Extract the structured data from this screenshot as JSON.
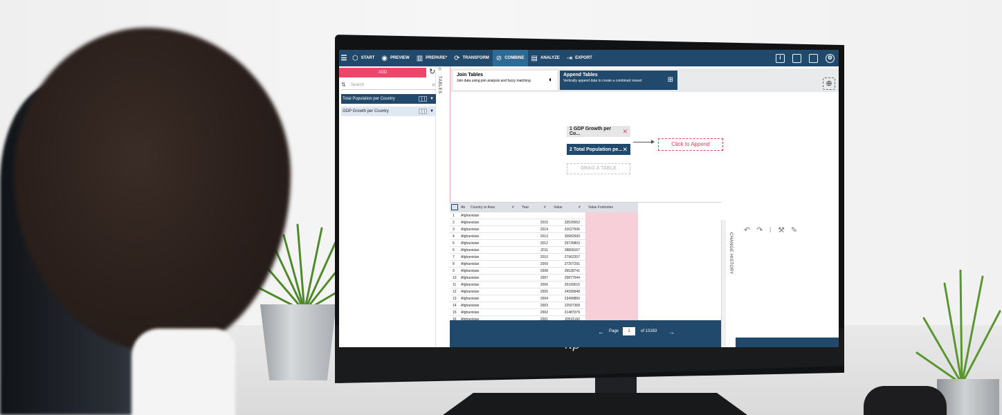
{
  "toolbar": {
    "items": [
      {
        "label": "START",
        "icon": "cube-icon"
      },
      {
        "label": "PREVIEW",
        "icon": "eye-icon"
      },
      {
        "label": "PREPARE*",
        "icon": "columns-icon"
      },
      {
        "label": "TRANSFORM",
        "icon": "cycle-icon"
      },
      {
        "label": "COMBINE",
        "icon": "combine-icon",
        "active": true
      },
      {
        "label": "ANALYZE",
        "icon": "clipboard-icon"
      },
      {
        "label": "EXPORT",
        "icon": "export-arrow-icon"
      }
    ]
  },
  "left_panel": {
    "add_label": "ADD",
    "search_placeholder": "Search",
    "tables_label": "TABLES",
    "tables": [
      {
        "name": "Total Population per Country",
        "selected": true
      },
      {
        "name": "GDP Growth per Country",
        "selected": false
      }
    ]
  },
  "combine": {
    "join": {
      "title": "Join Tables",
      "desc": "Join data using join analysis and fuzzy matching"
    },
    "append": {
      "title": "Append Tables",
      "desc": "Vertically append data to create a combined rowset"
    },
    "blocks": [
      {
        "label": "1  GDP Growth per Co..."
      },
      {
        "label": "2  Total Population pe..."
      }
    ],
    "drag_label": "DRAG A TABLE",
    "append_target": "Click to Append"
  },
  "grid": {
    "headers": {
      "type_a": "Ab",
      "country": "Country or Area",
      "type_hash1": "#",
      "year": "Year",
      "type_hash2": "#",
      "value": "Value",
      "type_hash3": "#",
      "footnotes": "Value Footnotes"
    },
    "rows": [
      {
        "n": "1",
        "country": "Afghanistan",
        "year": "",
        "value": ""
      },
      {
        "n": "2",
        "country": "Afghanistan",
        "year": "2015",
        "value": "32526562"
      },
      {
        "n": "3",
        "country": "Afghanistan",
        "year": "2014",
        "value": "31627506"
      },
      {
        "n": "4",
        "country": "Afghanistan",
        "year": "2013",
        "value": "30682500"
      },
      {
        "n": "5",
        "country": "Afghanistan",
        "year": "2012",
        "value": "29726803"
      },
      {
        "n": "6",
        "country": "Afghanistan",
        "year": "2011",
        "value": "28809167"
      },
      {
        "n": "7",
        "country": "Afghanistan",
        "year": "2010",
        "value": "27962207"
      },
      {
        "n": "8",
        "country": "Afghanistan",
        "year": "2009",
        "value": "27207291"
      },
      {
        "n": "9",
        "country": "Afghanistan",
        "year": "2008",
        "value": "26528741"
      },
      {
        "n": "10",
        "country": "Afghanistan",
        "year": "2007",
        "value": "25877544"
      },
      {
        "n": "11",
        "country": "Afghanistan",
        "year": "2006",
        "value": "25183615"
      },
      {
        "n": "12",
        "country": "Afghanistan",
        "year": "2005",
        "value": "24399948"
      },
      {
        "n": "13",
        "country": "Afghanistan",
        "year": "2004",
        "value": "23499850"
      },
      {
        "n": "14",
        "country": "Afghanistan",
        "year": "2003",
        "value": "22507368"
      },
      {
        "n": "15",
        "country": "Afghanistan",
        "year": "2002",
        "value": "21487079"
      },
      {
        "n": "16",
        "country": "Afghanistan",
        "year": "2001",
        "value": "20531160"
      }
    ],
    "pager": {
      "page_label": "Page",
      "page_value": "1",
      "of_label": "of 13163"
    }
  },
  "history": {
    "label": "CHANGE HISTORY"
  },
  "brand": {
    "logo": "hp"
  },
  "colors": {
    "nav": "#21496b",
    "active": "#2d6a95",
    "accent": "#f0456a",
    "footnote_fill": "#f7cfd9"
  }
}
